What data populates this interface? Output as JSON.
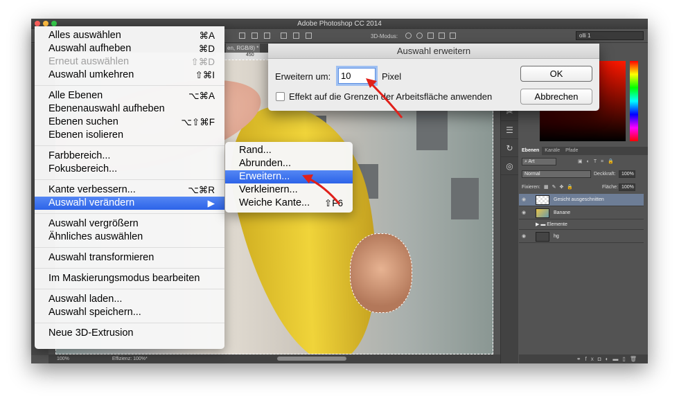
{
  "window": {
    "title": "Adobe Photoshop CC 2014"
  },
  "options_bar": {
    "mode_label": "3D-Modus:",
    "workspace": "olli 1"
  },
  "document_tab": {
    "label": "en, RGB/8) *"
  },
  "ruler": {
    "ticks": [
      "400",
      "450"
    ]
  },
  "status_bar": {
    "zoom": "100%",
    "info": "Effizienz: 100%*"
  },
  "select_menu": {
    "items": [
      {
        "label": "Alles auswählen",
        "shortcut": "⌘A"
      },
      {
        "label": "Auswahl aufheben",
        "shortcut": "⌘D"
      },
      {
        "label": "Erneut auswählen",
        "shortcut": "⇧⌘D",
        "disabled": true
      },
      {
        "label": "Auswahl umkehren",
        "shortcut": "⇧⌘I"
      },
      {
        "label": "Alle Ebenen",
        "shortcut": "⌥⌘A"
      },
      {
        "label": "Ebenenauswahl aufheben",
        "shortcut": ""
      },
      {
        "label": "Ebenen suchen",
        "shortcut": "⌥⇧⌘F"
      },
      {
        "label": "Ebenen isolieren",
        "shortcut": ""
      },
      {
        "label": "Farbbereich...",
        "shortcut": ""
      },
      {
        "label": "Fokusbereich...",
        "shortcut": ""
      },
      {
        "label": "Kante verbessern...",
        "shortcut": "⌥⌘R"
      },
      {
        "label": "Auswahl verändern",
        "shortcut": "▶",
        "highlighted": true
      },
      {
        "label": "Auswahl vergrößern",
        "shortcut": ""
      },
      {
        "label": "Ähnliches auswählen",
        "shortcut": ""
      },
      {
        "label": "Auswahl transformieren",
        "shortcut": ""
      },
      {
        "label": "Im Maskierungsmodus bearbeiten",
        "shortcut": ""
      },
      {
        "label": "Auswahl laden...",
        "shortcut": ""
      },
      {
        "label": "Auswahl speichern...",
        "shortcut": ""
      },
      {
        "label": "Neue 3D-Extrusion",
        "shortcut": ""
      }
    ]
  },
  "submenu": {
    "items": [
      {
        "label": "Rand...",
        "shortcut": ""
      },
      {
        "label": "Abrunden...",
        "shortcut": ""
      },
      {
        "label": "Erweitern...",
        "shortcut": "",
        "highlighted": true
      },
      {
        "label": "Verkleinern...",
        "shortcut": ""
      },
      {
        "label": "Weiche Kante...",
        "shortcut": "⇧F6"
      }
    ]
  },
  "dialog": {
    "title": "Auswahl erweitern",
    "expand_label": "Erweitern um:",
    "expand_value": "10",
    "unit": "Pixel",
    "checkbox_label": "Effekt auf die Grenzen der Arbeitsfläche anwenden",
    "checkbox_checked": false,
    "ok": "OK",
    "cancel": "Abbrechen"
  },
  "layers_panel": {
    "tabs": [
      "Ebenen",
      "Kanäle",
      "Pfade"
    ],
    "filter": "Art",
    "blend_mode": "Normal",
    "opacity_label": "Deckkraft:",
    "opacity": "100%",
    "lock_label": "Fixieren:",
    "fill_label": "Fläche:",
    "fill": "100%",
    "layers": [
      {
        "name": "Gesicht ausgeschnitten",
        "visible": true,
        "selected": true
      },
      {
        "name": "Banane",
        "visible": true
      },
      {
        "name": "Elemente",
        "visible": false,
        "group": true
      },
      {
        "name": "hg",
        "visible": true
      }
    ]
  },
  "colors": {
    "highlight": "#3a6ff0",
    "selected_layer": "#6d7d96",
    "annotation_arrow": "#e0201a"
  }
}
